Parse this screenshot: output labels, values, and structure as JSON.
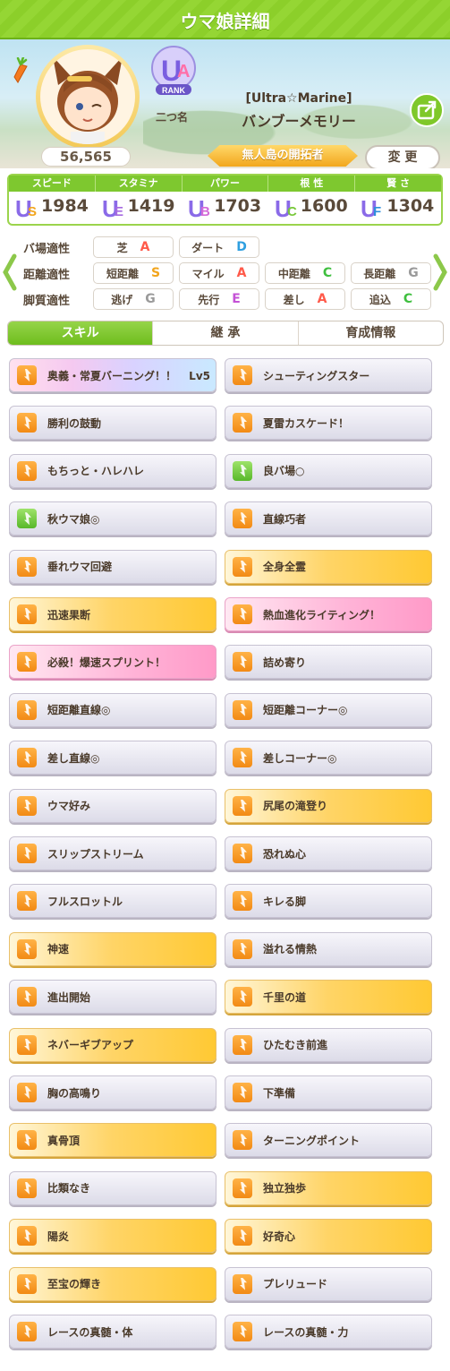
{
  "header": {
    "title": "ウマ娘詳細"
  },
  "profile": {
    "score": "56,565",
    "rank_sub": "二つ名",
    "name_sub": "[Ultra☆Marine]",
    "name": "バンブーメモリー",
    "title": "無人島の開拓者",
    "change_label": "変 更",
    "title_sub": "－"
  },
  "stats": {
    "headers": [
      "スピード",
      "スタミナ",
      "パワー",
      "根 性",
      "賢 さ"
    ],
    "values": [
      "1984",
      "1419",
      "1703",
      "1600",
      "1304"
    ],
    "grades": [
      "US",
      "UE",
      "UB",
      "UC",
      "UF"
    ]
  },
  "aptitude": {
    "rows": [
      {
        "label": "バ場適性",
        "cells": [
          {
            "name": "芝",
            "grade": "A"
          },
          {
            "name": "ダート",
            "grade": "D"
          }
        ]
      },
      {
        "label": "距離適性",
        "cells": [
          {
            "name": "短距離",
            "grade": "S"
          },
          {
            "name": "マイル",
            "grade": "A"
          },
          {
            "name": "中距離",
            "grade": "C"
          },
          {
            "name": "長距離",
            "grade": "G"
          }
        ]
      },
      {
        "label": "脚質適性",
        "cells": [
          {
            "name": "逃げ",
            "grade": "G"
          },
          {
            "name": "先行",
            "grade": "E"
          },
          {
            "name": "差し",
            "grade": "A"
          },
          {
            "name": "追込",
            "grade": "C"
          }
        ]
      }
    ]
  },
  "tabs": [
    "スキル",
    "継 承",
    "育成情報"
  ],
  "skills": [
    {
      "label": "奥義・常夏バーニング！！",
      "level": "Lv5",
      "tier": "rainbow",
      "icon": "orange"
    },
    {
      "label": "シューティングスター",
      "tier": "normal",
      "icon": "orange"
    },
    {
      "label": "勝利の鼓動",
      "tier": "normal",
      "icon": "orange"
    },
    {
      "label": "夏雷カスケード！",
      "tier": "normal",
      "icon": "orange"
    },
    {
      "label": "もちっと・ハレハレ",
      "tier": "normal",
      "icon": "orange"
    },
    {
      "label": "良バ場○",
      "tier": "normal",
      "icon": "green"
    },
    {
      "label": "秋ウマ娘◎",
      "tier": "normal",
      "icon": "green"
    },
    {
      "label": "直線巧者",
      "tier": "normal",
      "icon": "orange"
    },
    {
      "label": "垂れウマ回避",
      "tier": "normal",
      "icon": "orange"
    },
    {
      "label": "全身全霊",
      "tier": "gold",
      "icon": "orange"
    },
    {
      "label": "迅速果断",
      "tier": "gold",
      "icon": "orange"
    },
    {
      "label": "熱血進化ライティング！",
      "tier": "pink",
      "icon": "orange"
    },
    {
      "label": "必殺！爆速スプリント！",
      "tier": "pink",
      "icon": "orange"
    },
    {
      "label": "詰め寄り",
      "tier": "normal",
      "icon": "orange"
    },
    {
      "label": "短距離直線◎",
      "tier": "normal",
      "icon": "orange"
    },
    {
      "label": "短距離コーナー◎",
      "tier": "normal",
      "icon": "orange"
    },
    {
      "label": "差し直線◎",
      "tier": "normal",
      "icon": "orange"
    },
    {
      "label": "差しコーナー◎",
      "tier": "normal",
      "icon": "orange"
    },
    {
      "label": "ウマ好み",
      "tier": "normal",
      "icon": "orange"
    },
    {
      "label": "尻尾の滝登り",
      "tier": "gold",
      "icon": "orange"
    },
    {
      "label": "スリップストリーム",
      "tier": "normal",
      "icon": "orange"
    },
    {
      "label": "恐れぬ心",
      "tier": "normal",
      "icon": "orange"
    },
    {
      "label": "フルスロットル",
      "tier": "normal",
      "icon": "orange"
    },
    {
      "label": "キレる脚",
      "tier": "normal",
      "icon": "orange"
    },
    {
      "label": "神速",
      "tier": "gold",
      "icon": "orange"
    },
    {
      "label": "溢れる情熱",
      "tier": "normal",
      "icon": "orange"
    },
    {
      "label": "進出開始",
      "tier": "normal",
      "icon": "orange"
    },
    {
      "label": "千里の道",
      "tier": "gold",
      "icon": "orange"
    },
    {
      "label": "ネバーギブアップ",
      "tier": "gold",
      "icon": "orange"
    },
    {
      "label": "ひたむき前進",
      "tier": "normal",
      "icon": "orange"
    },
    {
      "label": "胸の高鳴り",
      "tier": "normal",
      "icon": "orange"
    },
    {
      "label": "下準備",
      "tier": "normal",
      "icon": "orange"
    },
    {
      "label": "真骨頂",
      "tier": "gold",
      "icon": "orange"
    },
    {
      "label": "ターニングポイント",
      "tier": "normal",
      "icon": "orange"
    },
    {
      "label": "比類なき",
      "tier": "normal",
      "icon": "orange"
    },
    {
      "label": "独立独歩",
      "tier": "gold",
      "icon": "orange"
    },
    {
      "label": "陽炎",
      "tier": "gold",
      "icon": "orange"
    },
    {
      "label": "好奇心",
      "tier": "gold",
      "icon": "orange"
    },
    {
      "label": "至宝の輝き",
      "tier": "gold",
      "icon": "orange"
    },
    {
      "label": "プレリュード",
      "tier": "normal",
      "icon": "orange"
    },
    {
      "label": "レースの真髄・体",
      "tier": "normal",
      "icon": "orange"
    },
    {
      "label": "レースの真髄・力",
      "tier": "normal",
      "icon": "orange"
    }
  ]
}
